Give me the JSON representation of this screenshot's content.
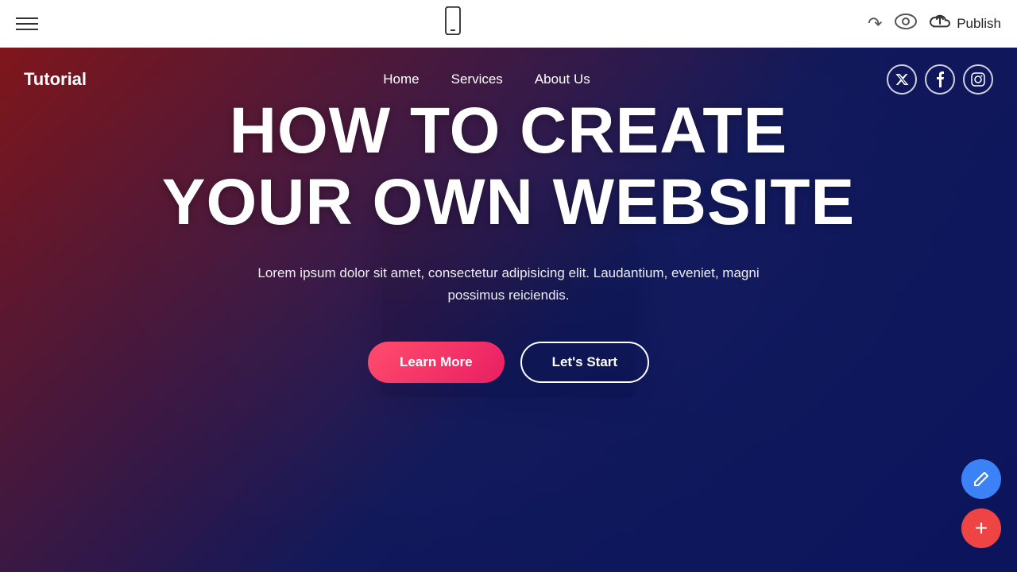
{
  "toolbar": {
    "hamburger_label": "menu",
    "undo_label": "↩",
    "preview_label": "👁",
    "publish_label": "Publish",
    "phone_view_label": "mobile view"
  },
  "site": {
    "logo": "Tutorial",
    "nav": {
      "links": [
        {
          "id": "home",
          "label": "Home"
        },
        {
          "id": "services",
          "label": "Services"
        },
        {
          "id": "about",
          "label": "About Us"
        }
      ]
    },
    "social": {
      "twitter_label": "𝕏",
      "facebook_label": "f",
      "instagram_label": "📷"
    },
    "hero": {
      "title_line1": "HOW TO CREATE",
      "title_line2": "YOUR OWN WEBSITE",
      "description": "Lorem ipsum dolor sit amet, consectetur adipisicing elit. Laudantium, eveniet, magni possimus reiciendis.",
      "btn_learn_more": "Learn More",
      "btn_lets_start": "Let's Start"
    }
  },
  "fab": {
    "edit_icon": "✏",
    "add_icon": "+"
  }
}
